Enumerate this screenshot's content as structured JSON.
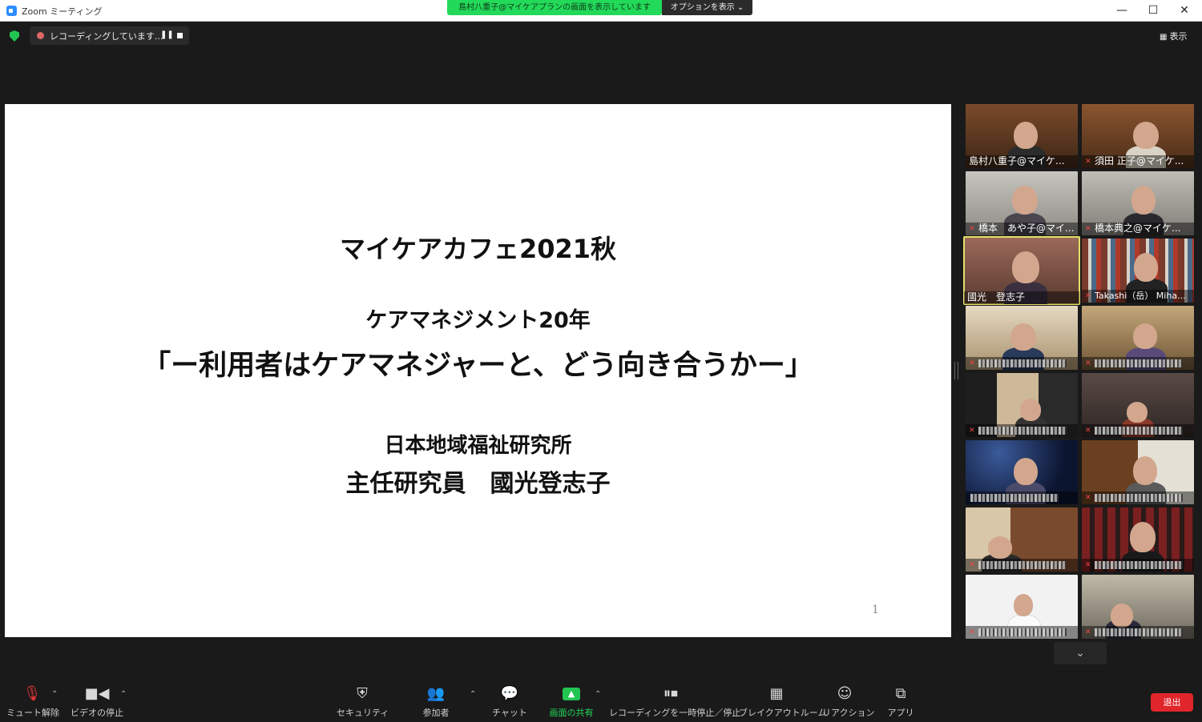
{
  "window": {
    "title": "Zoom ミーティング",
    "share_banner": "島村八重子@マイケアプランの画面を表示しています",
    "options_label": "オプションを表示 ⌄",
    "minimize": "—",
    "maximize": "☐",
    "close": "✕"
  },
  "recording": {
    "label": "レコーディングしています...",
    "pause_glyph": "❚❚"
  },
  "view": {
    "label": "表示",
    "icon_glyph": "▦"
  },
  "slide": {
    "line1": "マイケアカフェ2021秋",
    "line2": "ケアマネジメント20年",
    "line3": "「ー利用者はケアマネジャーと、どう向き合うかー」",
    "line4": "日本地域福祉研究所",
    "line5": "主任研究員　國光登志子",
    "page_number": "1"
  },
  "participants": [
    {
      "name": "島村八重子@マイケ...",
      "mic_muted": false
    },
    {
      "name": "須田 正子@マイケ...",
      "mic_muted": true
    },
    {
      "name": "橋本　あや子@マイ...",
      "mic_muted": true
    },
    {
      "name": "橋本典之@マイケ...",
      "mic_muted": true
    },
    {
      "name": "國光　登志子",
      "mic_muted": false,
      "active": true
    },
    {
      "name": "Takashi（岳） Miha...",
      "mic_muted": true
    },
    {
      "name": "",
      "mic_muted": true
    },
    {
      "name": "",
      "mic_muted": true
    },
    {
      "name": "",
      "mic_muted": true
    },
    {
      "name": "",
      "mic_muted": true
    },
    {
      "name": "",
      "mic_muted": false
    },
    {
      "name": "",
      "mic_muted": true
    },
    {
      "name": "",
      "mic_muted": true
    },
    {
      "name": "",
      "mic_muted": true
    },
    {
      "name": "",
      "mic_muted": true
    },
    {
      "name": "",
      "mic_muted": true
    }
  ],
  "toolbar": {
    "mute": "ミュート解除",
    "video": "ビデオの停止",
    "security": "セキュリティ",
    "participants": "参加者",
    "chat": "チャット",
    "share": "画面の共有",
    "recording": "レコーディングを一時停止／停止",
    "breakout": "ブレイクアウトルーム",
    "reaction": "リアクション",
    "apps": "アプリ",
    "leave": "退出",
    "caret": "⌃",
    "scroll_down": "⌄"
  },
  "colors": {
    "share_green": "#23d959",
    "leave_red": "#e0262a",
    "active_speaker": "#e4e06a"
  }
}
